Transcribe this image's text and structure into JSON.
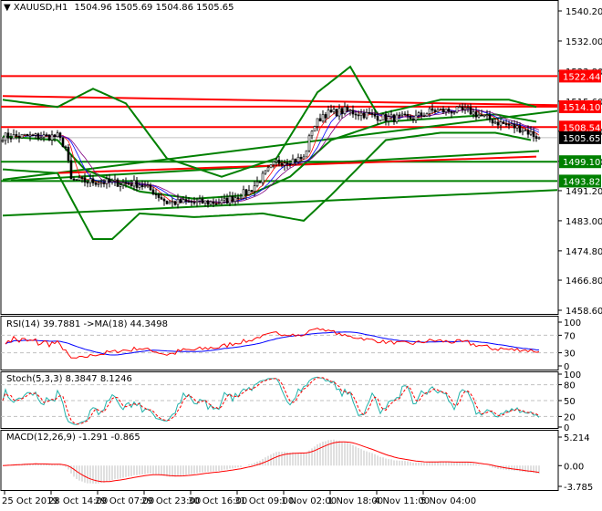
{
  "header": {
    "symbol": "XAUUSD,H1",
    "ohlc": "1504.96 1505.69 1504.86 1505.65"
  },
  "colors": {
    "up": "#ffffff",
    "down": "#000000",
    "resistance": "#ff0000",
    "support": "#008000",
    "bands": "#008000",
    "rsi": "#ff0000",
    "rsi_ma": "#0000ff",
    "stoch_main": "#20b2aa",
    "stoch_signal": "#ff0000",
    "macd": "#c0c0c0",
    "macd_signal": "#ff0000"
  },
  "chart_data": [
    {
      "type": "candlestick",
      "title": "XAUUSD,H1",
      "ylim": [
        1458.6,
        1540.2
      ],
      "y_ticks": [
        "1540.20",
        "1532.00",
        "1523.80",
        "1515.60",
        "1507.40",
        "1499.20",
        "1491.20",
        "1483.00",
        "1474.80",
        "1466.80",
        "1458.60"
      ],
      "x_ticks": [
        "25 Oct 2019",
        "28 Oct 14:00",
        "29 Oct 07:00",
        "29 Oct 23:00",
        "30 Oct 16:00",
        "31 Oct 09:00",
        "1 Nov 02:00",
        "1 Nov 18:00",
        "4 Nov 11:00",
        "5 Nov 04:00"
      ],
      "bars": 200,
      "close_keypoints": [
        [
          0,
          1506
        ],
        [
          20,
          1506
        ],
        [
          23,
          1503
        ],
        [
          25,
          1494
        ],
        [
          50,
          1493
        ],
        [
          55,
          1491
        ],
        [
          60,
          1488
        ],
        [
          80,
          1488
        ],
        [
          90,
          1491
        ],
        [
          95,
          1495
        ],
        [
          100,
          1499
        ],
        [
          110,
          1500
        ],
        [
          113,
          1508
        ],
        [
          117,
          1512
        ],
        [
          125,
          1513
        ],
        [
          140,
          1511
        ],
        [
          150,
          1511
        ],
        [
          157,
          1513
        ],
        [
          170,
          1513
        ],
        [
          180,
          1510
        ],
        [
          190,
          1508
        ],
        [
          196,
          1505.65
        ]
      ],
      "bollinger": {
        "upper": [
          [
            0,
            1516
          ],
          [
            20,
            1514
          ],
          [
            33,
            1519
          ],
          [
            45,
            1515
          ],
          [
            60,
            1500
          ],
          [
            80,
            1495
          ],
          [
            100,
            1500
          ],
          [
            115,
            1518
          ],
          [
            127,
            1525
          ],
          [
            137,
            1512
          ],
          [
            160,
            1516
          ],
          [
            185,
            1516
          ],
          [
            195,
            1514
          ]
        ],
        "middle": [
          [
            0,
            1506
          ],
          [
            20,
            1505
          ],
          [
            30,
            1497
          ],
          [
            50,
            1491
          ],
          [
            70,
            1489
          ],
          [
            90,
            1490
          ],
          [
            105,
            1495
          ],
          [
            120,
            1505
          ],
          [
            140,
            1510
          ],
          [
            160,
            1511
          ],
          [
            180,
            1512
          ],
          [
            195,
            1510
          ]
        ],
        "lower": [
          [
            0,
            1497
          ],
          [
            20,
            1496
          ],
          [
            33,
            1478
          ],
          [
            40,
            1478
          ],
          [
            50,
            1485
          ],
          [
            70,
            1484
          ],
          [
            95,
            1485
          ],
          [
            110,
            1483
          ],
          [
            120,
            1490
          ],
          [
            140,
            1505
          ],
          [
            160,
            1507
          ],
          [
            180,
            1507
          ],
          [
            193,
            1505
          ]
        ]
      },
      "levels": [
        {
          "price": 1522.44,
          "label": "1522.44",
          "kind": "resistance"
        },
        {
          "price": 1514.1,
          "label": "1514.10",
          "kind": "resistance"
        },
        {
          "price": 1508.54,
          "label": "1508.54",
          "kind": "resistance"
        },
        {
          "price": 1499.1,
          "label": "1499.10",
          "kind": "support"
        },
        {
          "price": 1493.82,
          "label": "1493.82",
          "kind": "support"
        }
      ],
      "current_price": {
        "price": 1505.65,
        "label": "1505.65"
      },
      "trendlines": [
        {
          "kind": "resistance",
          "from": [
            0,
            1517
          ],
          "to": [
            203,
            1514.5
          ]
        },
        {
          "kind": "support",
          "from": [
            0,
            1484.4
          ],
          "to": [
            203,
            1491.4
          ]
        },
        {
          "kind": "support",
          "from": [
            0,
            1494.2
          ],
          "to": [
            203,
            1513
          ]
        },
        {
          "kind": "support",
          "from": [
            3,
            1494
          ],
          "to": [
            196,
            1502
          ]
        },
        {
          "kind": "resistance",
          "from": [
            20,
            1496
          ],
          "to": [
            195,
            1500.5
          ]
        }
      ]
    },
    {
      "type": "line",
      "title": "RSI(14) 39.7881  ->MA(18) 44.3498",
      "ylim": [
        0,
        100
      ],
      "y_ticks": [
        "100",
        "70",
        "30",
        "0"
      ],
      "levels": [
        70,
        30
      ],
      "last": {
        "rsi": 39.7881,
        "ma": 44.3498
      }
    },
    {
      "type": "line",
      "title": "Stoch(5,3,3) 8.3847 8.1246",
      "ylim": [
        0,
        100
      ],
      "y_ticks": [
        "100",
        "80",
        "50",
        "20",
        "0"
      ],
      "levels": [
        80,
        50,
        20
      ],
      "last": {
        "main": 8.3847,
        "signal": 8.1246
      }
    },
    {
      "type": "bar",
      "title": "MACD(12,26,9) -1.291 -0.865",
      "ylim": [
        -3.785,
        5.214
      ],
      "y_ticks": [
        "5.214",
        "0.00",
        "-3.785"
      ],
      "last": {
        "macd": -1.291,
        "signal": -0.865
      }
    }
  ]
}
